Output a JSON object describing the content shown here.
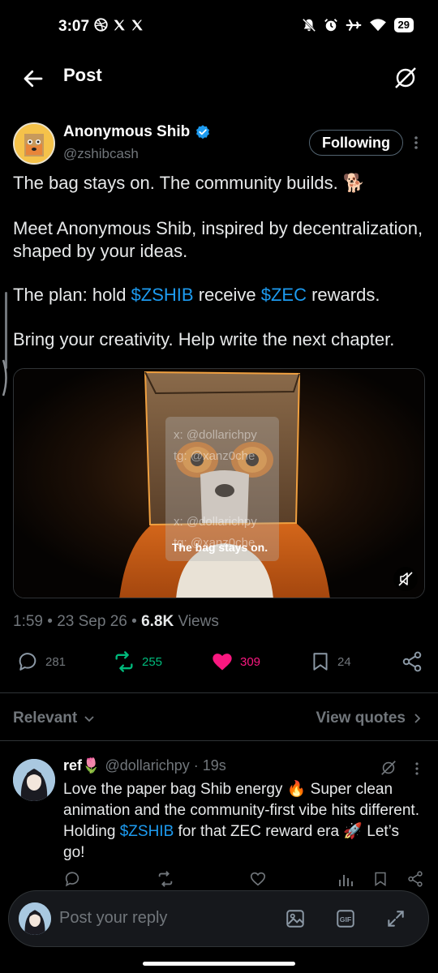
{
  "status_bar": {
    "time": "3:07",
    "battery": "29",
    "left_icons": [
      "dribbble-icon",
      "x-logo-icon",
      "x-logo-icon"
    ],
    "right_icons": [
      "bell-off-icon",
      "alarm-icon",
      "airplane-icon",
      "wifi-icon",
      "battery-icon"
    ]
  },
  "header": {
    "title": "Post"
  },
  "author": {
    "name": "Anonymous Shib",
    "handle": "@zshibcash",
    "verified": true,
    "follow_label": "Following"
  },
  "tweet": {
    "line1": "The bag stays on. The community builds. 🐕",
    "para2": "Meet Anonymous Shib, inspired by decentralization, shaped by your ideas.",
    "para3_prefix": "The plan: hold ",
    "para3_tag1": "$ZSHIB",
    "para3_mid": " receive ",
    "para3_tag2": "$ZEC",
    "para3_suffix": " rewards.",
    "para4": "Bring your creativity. Help write the next chapter."
  },
  "media": {
    "watermark_1": "x: @dollarichpy",
    "watermark_2": "tg: @xanz0che",
    "watermark_3": "x: @dollarichpy",
    "watermark_4": "tg: @xanz0che",
    "caption": "The bag stays on."
  },
  "meta": {
    "time": "1:59",
    "sep1": " • ",
    "date": "23 Sep 26",
    "sep2": " • ",
    "views_count": "6.8K",
    "views_label": " Views"
  },
  "actions": {
    "replies": "281",
    "reposts": "255",
    "likes": "309",
    "bookmarks": "24",
    "colors": {
      "repost": "#00ba7c",
      "like": "#f91880"
    }
  },
  "filters": {
    "relevant_label": "Relevant",
    "view_quotes_label": "View quotes"
  },
  "reply": {
    "name": "ref",
    "name_emoji": "🌷",
    "handle": "@dollarichpy",
    "time_sep": " · ",
    "time": "19s",
    "text_part1": "Love the paper bag Shib energy 🔥 Super clean animation and the community-first vibe hits different. Holding ",
    "text_tag": "$ZSHIB",
    "text_part2": " for that ZEC reward era 🚀 Let’s go!"
  },
  "compose": {
    "placeholder": "Post your reply"
  }
}
